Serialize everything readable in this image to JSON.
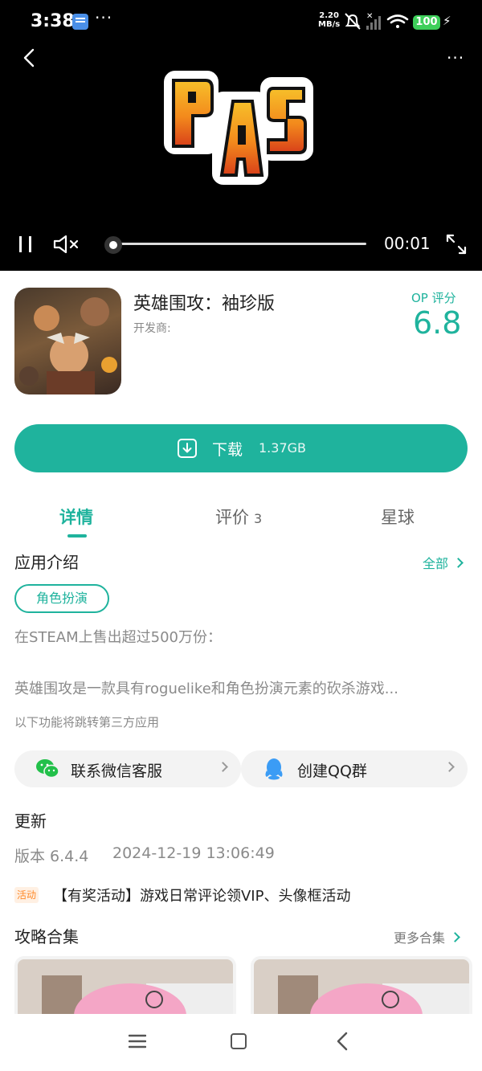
{
  "status_bar": {
    "time": "3:38",
    "speed_value": "2.20",
    "speed_unit": "MB/s",
    "battery": "100",
    "more": "···"
  },
  "video": {
    "current_time": "00:01",
    "logo_text": "PAS",
    "more": "···"
  },
  "app": {
    "title": "英雄围攻：袖珍版",
    "developer_label": "开发商:",
    "score_label": "OP 评分",
    "score": "6.8"
  },
  "download": {
    "label": "下载",
    "size": "1.37GB"
  },
  "tabs": [
    {
      "label": "详情",
      "count": ""
    },
    {
      "label": "评价",
      "count": "3"
    },
    {
      "label": "星球",
      "count": ""
    }
  ],
  "intro": {
    "title": "应用介绍",
    "all_link": "全部",
    "tag": "角色扮演",
    "line1": "在STEAM上售出超过500万份：",
    "line2": "英雄围攻是一款具有roguelike和角色扮演元素的砍杀游戏...",
    "third_party_note": "以下功能将跳转第三方应用"
  },
  "contact": {
    "wechat_label": "联系微信客服",
    "qq_label": "创建QQ群"
  },
  "update": {
    "title": "更新",
    "version": "版本 6.4.4",
    "date": "2024-12-19 13:06:49",
    "activity_badge": "活动",
    "activity_text": "【有奖活动】游戏日常评论领VIP、头像框活动"
  },
  "guides": {
    "title": "攻略合集",
    "more_link": "更多合集"
  },
  "colors": {
    "accent": "#1fb39d",
    "activity": "#ff8a2a"
  }
}
